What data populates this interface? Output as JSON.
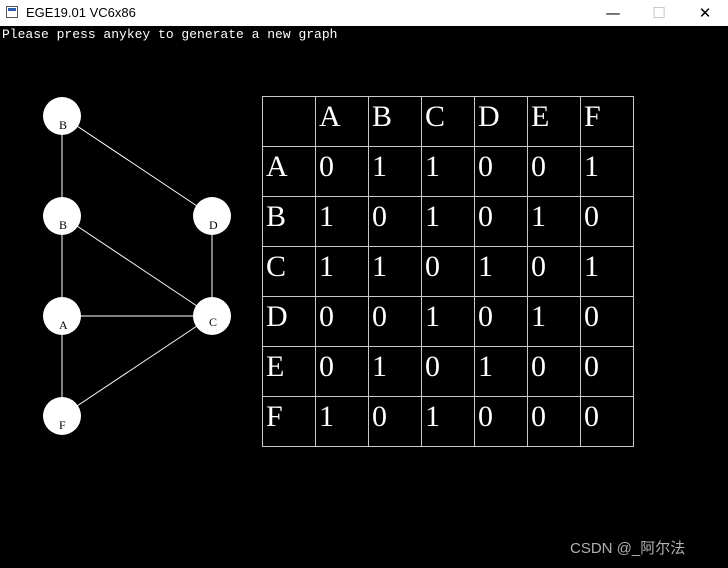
{
  "window": {
    "title": "EGE19.01 VC6x86",
    "buttons": {
      "minimize": "—",
      "maximize": "☐",
      "close": "✕"
    }
  },
  "console": {
    "prompt": "Please press anykey to generate a new graph"
  },
  "graph": {
    "nodes": [
      "B",
      "B",
      "D",
      "A",
      "C",
      "F"
    ],
    "edges": [
      [
        "B",
        "D"
      ],
      [
        "B",
        "B"
      ],
      [
        "B",
        "A"
      ],
      [
        "B",
        "C"
      ],
      [
        "D",
        "C"
      ],
      [
        "A",
        "C"
      ],
      [
        "A",
        "F"
      ],
      [
        "F",
        "C"
      ]
    ],
    "node_color": "#ffffff",
    "edge_color": "#ffffff"
  },
  "matrix": {
    "headers": [
      "",
      "A",
      "B",
      "C",
      "D",
      "E",
      "F"
    ],
    "rows": [
      {
        "label": "A",
        "values": [
          "0",
          "1",
          "1",
          "0",
          "0",
          "1"
        ]
      },
      {
        "label": "B",
        "values": [
          "1",
          "0",
          "1",
          "0",
          "1",
          "0"
        ]
      },
      {
        "label": "C",
        "values": [
          "1",
          "1",
          "0",
          "1",
          "0",
          "1"
        ]
      },
      {
        "label": "D",
        "values": [
          "0",
          "0",
          "1",
          "0",
          "1",
          "0"
        ]
      },
      {
        "label": "E",
        "values": [
          "0",
          "1",
          "0",
          "1",
          "0",
          "0"
        ]
      },
      {
        "label": "F",
        "values": [
          "1",
          "0",
          "1",
          "0",
          "0",
          "0"
        ]
      }
    ]
  },
  "watermark": "CSDN @_阿尔法"
}
